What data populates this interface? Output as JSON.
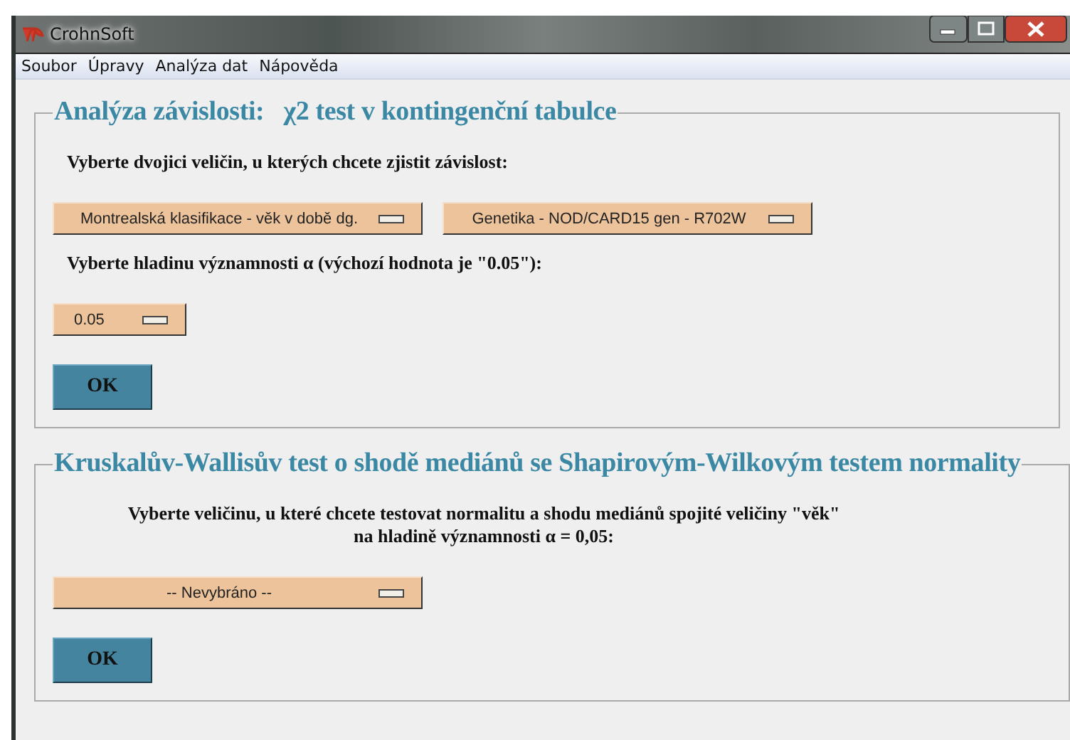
{
  "window": {
    "title": "CrohnSoft"
  },
  "menu": [
    "Soubor",
    "Úpravy",
    "Analýza dat",
    "Nápověda"
  ],
  "sections": [
    {
      "title": "Analýza závislosti:   χ2 test v kontingenční tabulce",
      "items": [
        {
          "kind": "label",
          "text": "Vyberte dvojici veličin, u kterých chcete zjistit závislost:"
        },
        {
          "kind": "dropdowns",
          "options": [
            {
              "value": "Montrealská klasifikace - věk v době dg."
            },
            {
              "value": "Genetika - NOD/CARD15 gen - R702W"
            }
          ]
        },
        {
          "kind": "label",
          "text": "Vyberte hladinu významnosti α (výchozí hodnota je \"0.05\"):"
        },
        {
          "kind": "dropdowns",
          "options": [
            {
              "value": "0.05"
            }
          ]
        },
        {
          "kind": "button",
          "text": "OK"
        }
      ]
    },
    {
      "title": "Kruskalův-Wallisův test o shodě mediánů se Shapirovým-Wilkovým testem normality",
      "items": [
        {
          "kind": "label",
          "text": "Vyberte veličinu, u které chcete testovat normalitu a shodu mediánů spojité veličiny \"věk\"\nna hladině významnosti α = 0,05:"
        },
        {
          "kind": "dropdowns",
          "options": [
            {
              "value": "-- Nevybráno --"
            }
          ]
        },
        {
          "kind": "button",
          "text": "OK"
        }
      ]
    }
  ]
}
